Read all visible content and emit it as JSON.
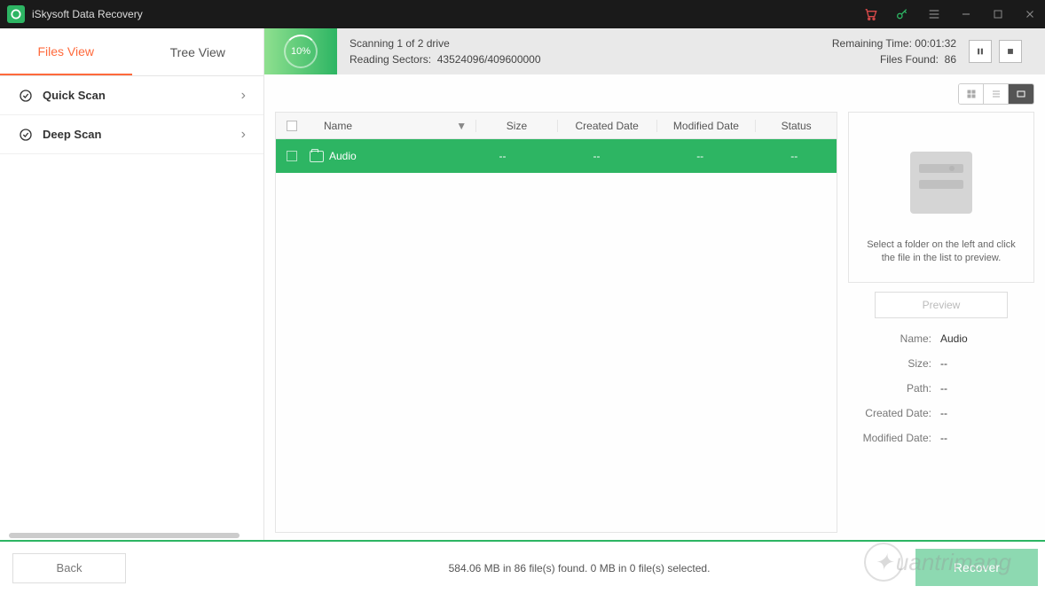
{
  "titlebar": {
    "title": "iSkysoft Data Recovery"
  },
  "sidebar": {
    "tabs": {
      "files": "Files View",
      "tree": "Tree View"
    },
    "items": [
      {
        "label": "Quick Scan"
      },
      {
        "label": "Deep Scan"
      }
    ]
  },
  "scan": {
    "percent": "10%",
    "line1": "Scanning 1 of 2 drive",
    "line2_label": "Reading Sectors:",
    "line2_value": "43524096/409600000",
    "remaining_label": "Remaining Time:",
    "remaining_value": "00:01:32",
    "found_label": "Files Found:",
    "found_value": "86"
  },
  "table": {
    "headers": {
      "name": "Name",
      "size": "Size",
      "created": "Created Date",
      "modified": "Modified Date",
      "status": "Status"
    },
    "rows": [
      {
        "name": "Audio",
        "size": "--",
        "created": "--",
        "modified": "--",
        "status": "--"
      }
    ]
  },
  "preview": {
    "placeholder_text": "Select a folder on the left and click the file in the list to preview.",
    "button": "Preview",
    "props": {
      "name_label": "Name:",
      "name_value": "Audio",
      "size_label": "Size:",
      "size_value": "--",
      "path_label": "Path:",
      "path_value": "--",
      "created_label": "Created Date:",
      "created_value": "--",
      "modified_label": "Modified Date:",
      "modified_value": "--"
    }
  },
  "footer": {
    "back": "Back",
    "status": "584.06 MB in 86 file(s) found.   0 MB in 0 file(s) selected.",
    "recover": "Recover"
  },
  "watermark": "uantrimang"
}
